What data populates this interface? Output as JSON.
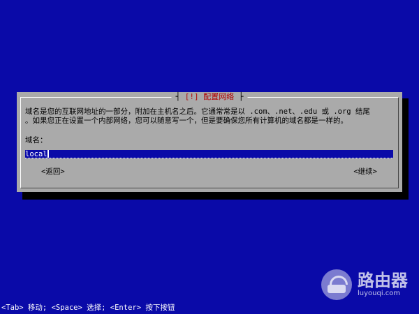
{
  "dialog": {
    "title": "[!] 配置网络",
    "description": "域名是您的互联网地址的一部分，附加在主机名之后。它通常常是以 .com、.net、.edu 或 .org 结尾。如果您正在设置一个内部网络，您可以随意写一个，但是要确保您所有计算机的域名都是一样的。",
    "description_line1": "域名是您的互联网地址的一部分，附加在主机名之后。它通常常是以 .com、.net、.edu 或 .org 结尾",
    "description_line2": "。如果您正在设置一个内部网络，您可以随意写一个，但是要确保您所有计算机的域名都是一样的。",
    "field_label": "域名：",
    "input_value": "local",
    "back_label": "<返回>",
    "continue_label": "<继续>"
  },
  "statusbar": {
    "text": "<Tab> 移动; <Space> 选择; <Enter> 按下按钮"
  },
  "watermark": {
    "icon": "router-logo-icon",
    "name": "路由器",
    "url": "luyouqi.com"
  },
  "colors": {
    "background": "#0a0aa8",
    "dialog": "#aaaaaa",
    "title": "#b00000",
    "input_bg": "#0a0aa8"
  }
}
